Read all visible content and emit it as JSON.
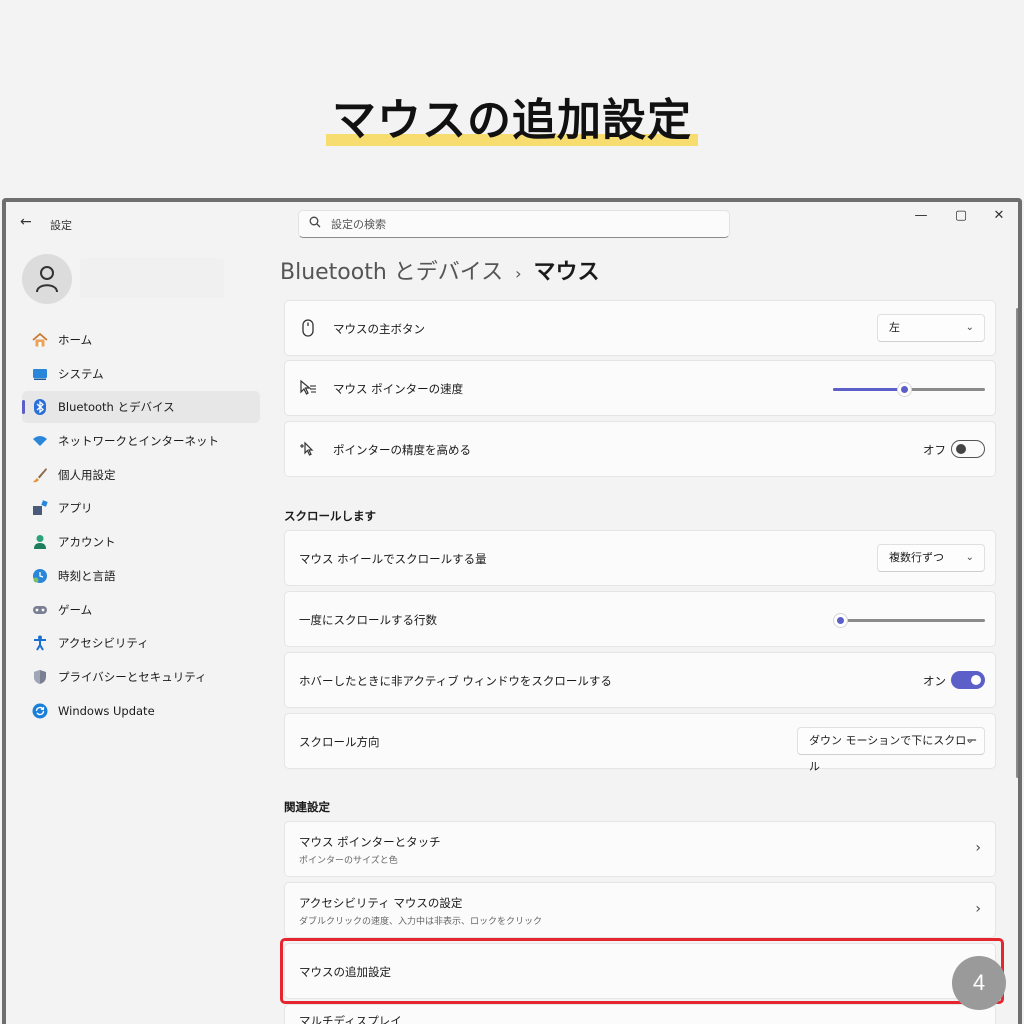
{
  "headline": "マウスの追加設定",
  "window": {
    "title": "設定",
    "search_placeholder": "設定の検索",
    "controls": {
      "minimize": "—",
      "maximize": "▢",
      "close": "✕"
    }
  },
  "sidebar": {
    "items": [
      {
        "label": "ホーム",
        "icon": "home-icon"
      },
      {
        "label": "システム",
        "icon": "system-icon"
      },
      {
        "label": "Bluetooth とデバイス",
        "icon": "bluetooth-icon",
        "active": true
      },
      {
        "label": "ネットワークとインターネット",
        "icon": "wifi-icon"
      },
      {
        "label": "個人用設定",
        "icon": "brush-icon"
      },
      {
        "label": "アプリ",
        "icon": "apps-icon"
      },
      {
        "label": "アカウント",
        "icon": "account-icon"
      },
      {
        "label": "時刻と言語",
        "icon": "time-language-icon"
      },
      {
        "label": "ゲーム",
        "icon": "gamepad-icon"
      },
      {
        "label": "アクセシビリティ",
        "icon": "accessibility-icon"
      },
      {
        "label": "プライバシーとセキュリティ",
        "icon": "shield-icon"
      },
      {
        "label": "Windows Update",
        "icon": "update-icon"
      }
    ]
  },
  "breadcrumb": {
    "parent": "Bluetooth とデバイス",
    "separator": "›",
    "current": "マウス"
  },
  "settings": {
    "primary_button": {
      "label": "マウスの主ボタン",
      "value": "左"
    },
    "pointer_speed": {
      "label": "マウス ポインターの速度",
      "level": 0.47
    },
    "pointer_precision": {
      "label": "ポインターの精度を高める",
      "state": "オフ"
    },
    "scroll_heading": "スクロールします",
    "wheel_scroll": {
      "label": "マウス ホイールでスクロールする量",
      "value": "複数行ずつ"
    },
    "lines_per_scroll": {
      "label": "一度にスクロールする行数",
      "level": 0.03
    },
    "inactive_scroll": {
      "label": "ホバーしたときに非アクティブ ウィンドウをスクロールする",
      "state": "オン"
    },
    "scroll_direction": {
      "label": "スクロール方向",
      "value": "ダウン モーションで下にスクロール"
    },
    "related_heading": "関連設定",
    "related": [
      {
        "label": "マウス ポインターとタッチ",
        "sub": "ポインターのサイズと色"
      },
      {
        "label": "アクセシビリティ マウスの設定",
        "sub": "ダブルクリックの速度、入力中は非表示、ロックをクリック"
      },
      {
        "label": "マウスの追加設定"
      },
      {
        "label": "マルチディスプレイ"
      }
    ]
  },
  "step_badge": "4",
  "colors": {
    "accent": "#5b5fc7",
    "highlight": "#e5262e",
    "headline_marker": "#f7dc6f"
  }
}
